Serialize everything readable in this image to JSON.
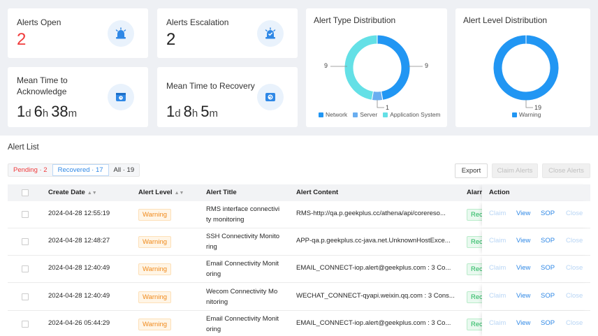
{
  "cards": {
    "alerts_open": {
      "title": "Alerts Open",
      "value": "2"
    },
    "alerts_escalation": {
      "title": "Alerts Escalation",
      "value": "2"
    },
    "mtta": {
      "title_line1": "Mean Time to",
      "title_line2": "Acknowledge",
      "d": "1",
      "d_unit": "d",
      "h": "6",
      "h_unit": "h",
      "m": "38",
      "m_unit": "m"
    },
    "mttr": {
      "title": "Mean Time to Recovery",
      "d": "1",
      "d_unit": "d",
      "h": "8",
      "h_unit": "h",
      "m": "5",
      "m_unit": "m"
    }
  },
  "charts": {
    "type_distribution": {
      "title": "Alert Type Distribution",
      "label_left": "9",
      "label_right": "9",
      "label_bottom": "1",
      "legend": [
        {
          "name": "Network",
          "color": "#2196f3"
        },
        {
          "name": "Server",
          "color": "#6aaef0"
        },
        {
          "name": "Application System",
          "color": "#64e0e6"
        }
      ]
    },
    "level_distribution": {
      "title": "Alert Level Distribution",
      "label_bottom": "19",
      "legend": [
        {
          "name": "Warning",
          "color": "#2196f3"
        }
      ]
    }
  },
  "chart_data": [
    {
      "type": "pie",
      "title": "Alert Type Distribution",
      "categories": [
        "Network",
        "Server",
        "Application System"
      ],
      "values": [
        9,
        1,
        9
      ]
    },
    {
      "type": "pie",
      "title": "Alert Level Distribution",
      "categories": [
        "Warning"
      ],
      "values": [
        19
      ]
    }
  ],
  "alert_list": {
    "title": "Alert List",
    "filters": {
      "pending": "Pending · 2",
      "recovered": "Recovered · 17",
      "all": "All · 19"
    },
    "buttons": {
      "export": "Export",
      "claim": "Claim Alerts",
      "close": "Close Alerts"
    },
    "columns": {
      "create_date": "Create Date",
      "alert_level": "Alert Level",
      "alert_title": "Alert Title",
      "alert_content": "Alert Content",
      "status": "Alarr",
      "action": "Action"
    },
    "action_labels": {
      "claim": "Claim",
      "view": "View",
      "sop": "SOP",
      "close": "Close"
    },
    "rows": [
      {
        "date": "2024-04-28 12:55:19",
        "level": "Warning",
        "title1": "RMS interface connectivi",
        "title2": "ty monitoring",
        "content": "RMS-http://qa.p.geekplus.cc/athena/api/coreresо...",
        "status": "Rec"
      },
      {
        "date": "2024-04-28 12:48:27",
        "level": "Warning",
        "title1": "SSH Connectivity Monito",
        "title2": "ring",
        "content": "APP-qa.p.geekplus.cc-java.net.UnknownHostExce...",
        "status": "Rec"
      },
      {
        "date": "2024-04-28 12:40:49",
        "level": "Warning",
        "title1": "Email Connectivity Monit",
        "title2": "oring",
        "content": "EMAIL_CONNECT-iop.alert@geekplus.com : 3 Co...",
        "status": "Rec"
      },
      {
        "date": "2024-04-28 12:40:49",
        "level": "Warning",
        "title1": "Wecom Connectivity Mo",
        "title2": "nitoring",
        "content": "WECHAT_CONNECT-qyapi.weixin.qq.com : 3 Cons...",
        "status": "Rec"
      },
      {
        "date": "2024-04-26 05:44:29",
        "level": "Warning",
        "title1": "Email Connectivity Monit",
        "title2": "oring",
        "content": "EMAIL_CONNECT-iop.alert@geekplus.com : 3 Co...",
        "status": "Rec"
      }
    ]
  }
}
